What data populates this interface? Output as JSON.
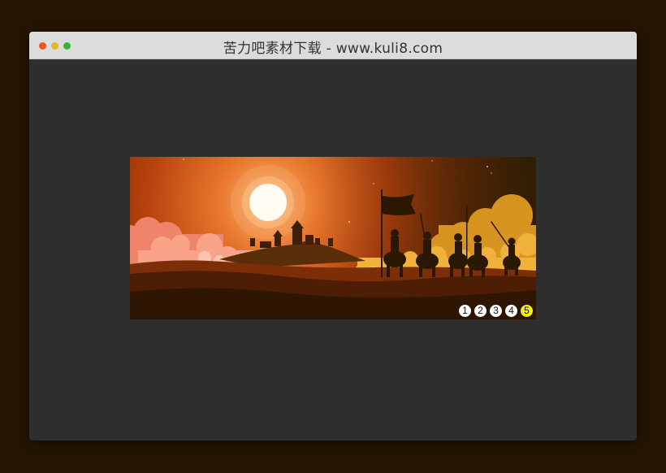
{
  "window": {
    "title": "苦力吧素材下载 - www.kuli8.com",
    "traffic_lights": {
      "close": "#f2541b",
      "minimize": "#e6b424",
      "maximize": "#39b33a"
    }
  },
  "slider": {
    "image_description_icon": "sunset-castle-riders-illustration",
    "pager": [
      {
        "label": "1",
        "active": false
      },
      {
        "label": "2",
        "active": false
      },
      {
        "label": "3",
        "active": false
      },
      {
        "label": "4",
        "active": false
      },
      {
        "label": "5",
        "active": true
      }
    ],
    "colors": {
      "active_dot": "#f5f00a",
      "inactive_dot": "#ffffff"
    }
  }
}
